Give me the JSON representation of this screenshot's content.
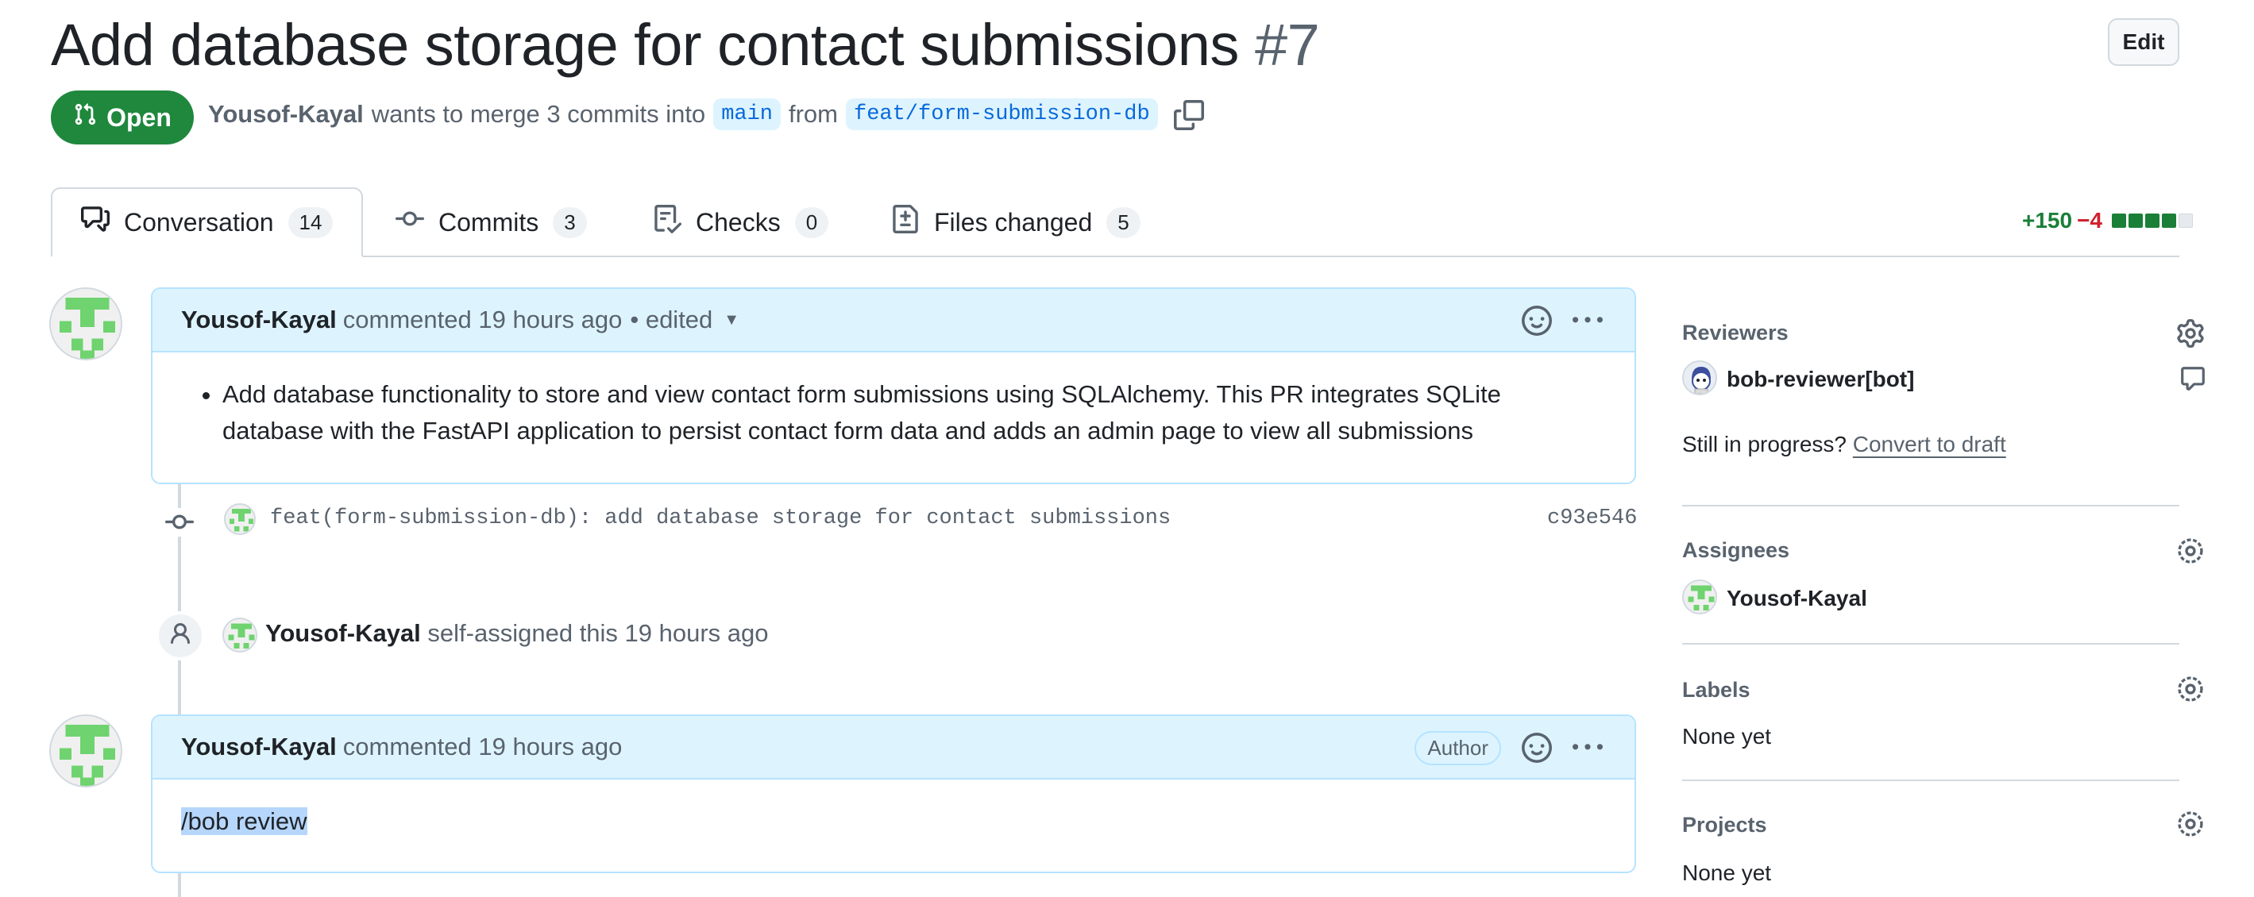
{
  "pr": {
    "title": "Add database storage for contact submissions",
    "number": "#7",
    "edit_label": "Edit",
    "state": "Open",
    "author": "Yousof-Kayal",
    "merge_text": "wants to merge 3 commits into",
    "base_branch": "main",
    "from_text": "from",
    "head_branch": "feat/form-submission-db"
  },
  "tabs": [
    {
      "label": "Conversation",
      "count": "14",
      "icon": "comment-discussion-icon"
    },
    {
      "label": "Commits",
      "count": "3",
      "icon": "git-commit-icon"
    },
    {
      "label": "Checks",
      "count": "0",
      "icon": "checklist-icon"
    },
    {
      "label": "Files changed",
      "count": "5",
      "icon": "file-diff-icon"
    }
  ],
  "diffstat": {
    "additions": "+150",
    "deletions": "−4",
    "colors": [
      "#1a7f37",
      "#1a7f37",
      "#1a7f37",
      "#1a7f37",
      "#e6e9ed"
    ]
  },
  "timeline": {
    "comment1": {
      "author": "Yousof-Kayal",
      "meta": "commented 19 hours ago",
      "edited": "• edited",
      "body": "Add database functionality to store and view contact form submissions using SQLAlchemy. This PR integrates SQLite database with the FastAPI application to persist contact form data and adds an admin page to view all submissions"
    },
    "commit": {
      "message": "feat(form-submission-db): add database storage for contact submissions",
      "sha": "c93e546"
    },
    "event": {
      "actor": "Yousof-Kayal",
      "text": "self-assigned this 19 hours ago"
    },
    "comment2": {
      "author": "Yousof-Kayal",
      "meta": "commented 19 hours ago",
      "badge": "Author",
      "body": "/bob review"
    }
  },
  "sidebar": {
    "reviewers": {
      "heading": "Reviewers",
      "name": "bob-reviewer[bot]",
      "draft_prompt": "Still in progress?",
      "draft_link": "Convert to draft"
    },
    "assignees": {
      "heading": "Assignees",
      "name": "Yousof-Kayal"
    },
    "labels": {
      "heading": "Labels",
      "value": "None yet"
    },
    "projects": {
      "heading": "Projects",
      "value": "None yet"
    }
  },
  "colors": {
    "open": "#1f883d",
    "accent": "#0969da",
    "comment_header": "#ddf4ff",
    "avatar_green": "#6fd36f"
  }
}
